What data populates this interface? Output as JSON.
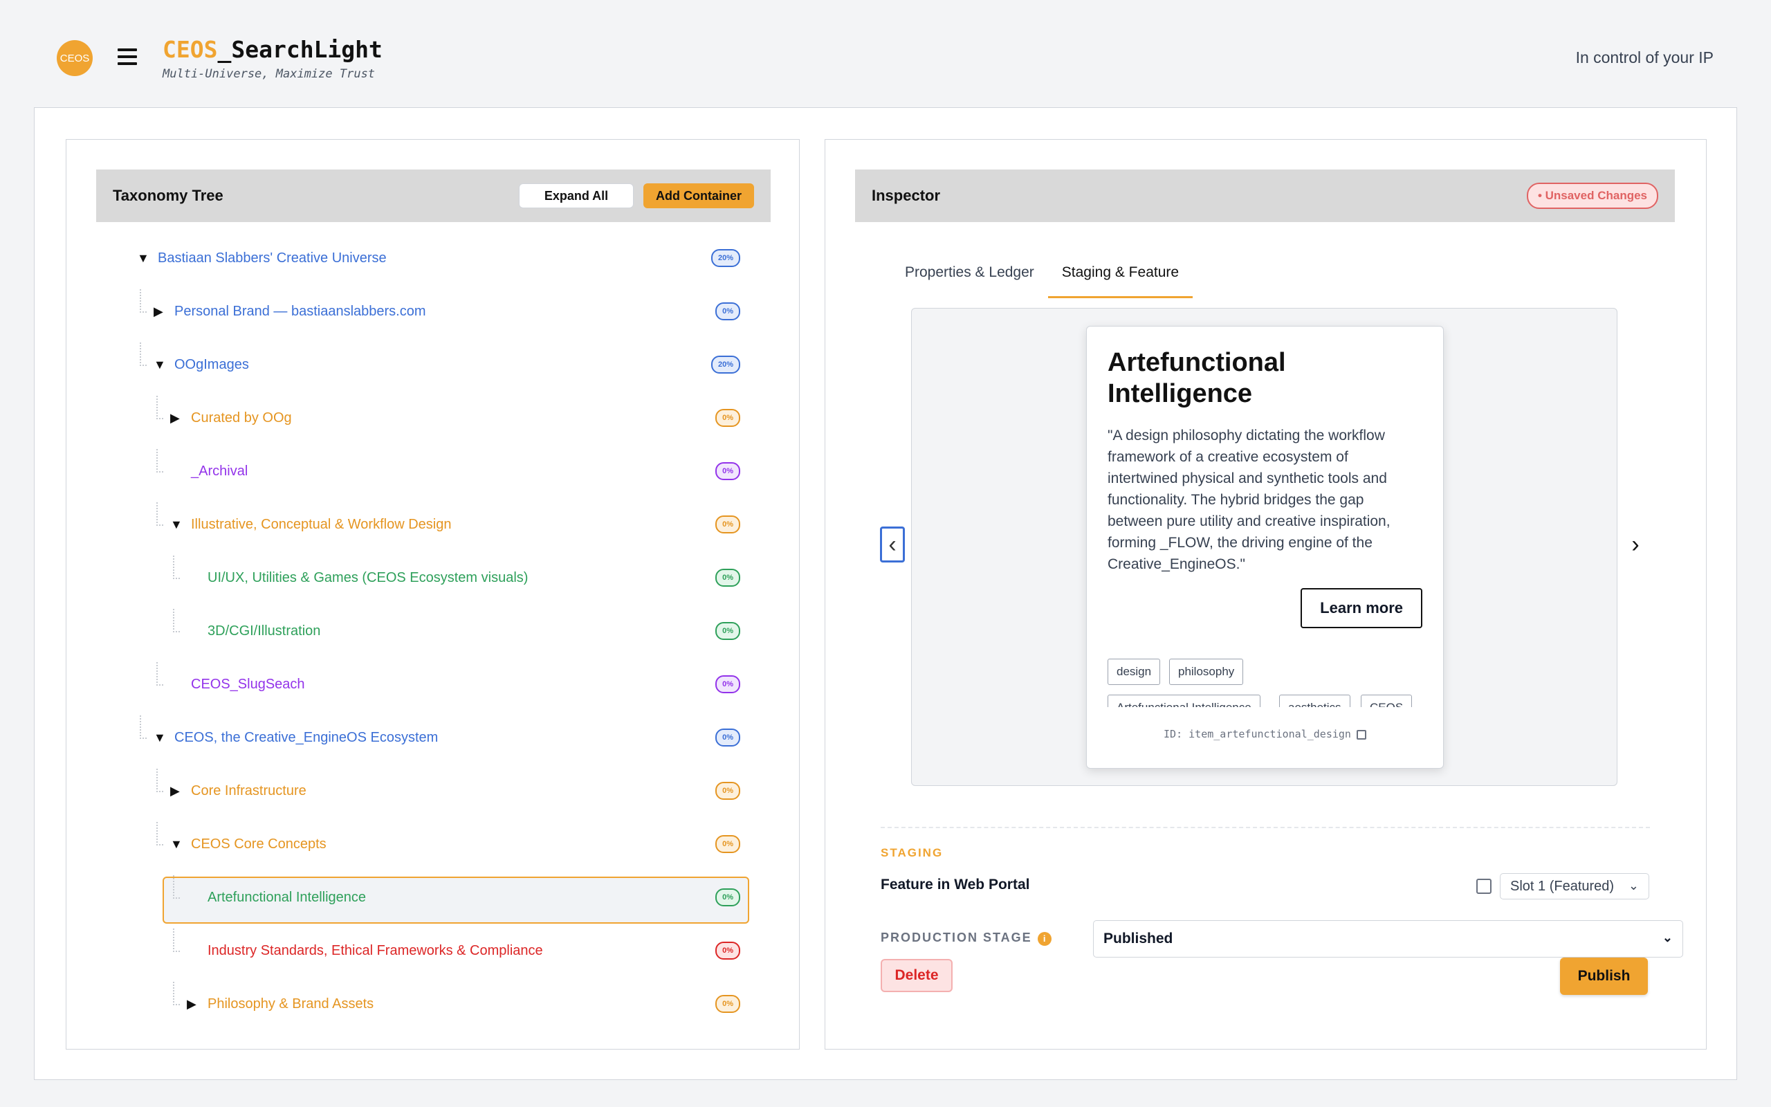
{
  "header": {
    "logo_text": "CEOS",
    "brand_accent": "CEOS",
    "brand_rest": "_SearchLight",
    "subtitle": "Multi-Universe, Maximize Trust",
    "tagline": "In control of your IP"
  },
  "taxonomy": {
    "title": "Taxonomy Tree",
    "expand_all": "Expand All",
    "add_container": "Add Container",
    "nodes": [
      {
        "label": "Bastiaan Slabbers' Creative Universe",
        "pct": "20%",
        "toggle": "▼",
        "color": "blue",
        "depth": 0
      },
      {
        "label": "Personal Brand — bastiaanslabbers.com",
        "pct": "0%",
        "toggle": "▶",
        "color": "blue",
        "depth": 1
      },
      {
        "label": "OOgImages",
        "pct": "20%",
        "toggle": "▼",
        "color": "blue",
        "depth": 1
      },
      {
        "label": "Curated by OOg",
        "pct": "0%",
        "toggle": "▶",
        "color": "orange",
        "depth": 2
      },
      {
        "label": "_Archival",
        "pct": "0%",
        "toggle": "",
        "color": "purple",
        "depth": 2
      },
      {
        "label": "Illustrative, Conceptual & Workflow Design",
        "pct": "0%",
        "toggle": "▼",
        "color": "orange",
        "depth": 2
      },
      {
        "label": "UI/UX, Utilities & Games (CEOS Ecosystem visuals)",
        "pct": "0%",
        "toggle": "",
        "color": "green",
        "depth": 3
      },
      {
        "label": "3D/CGI/Illustration",
        "pct": "0%",
        "toggle": "",
        "color": "green",
        "depth": 3
      },
      {
        "label": "CEOS_SlugSeach",
        "pct": "0%",
        "toggle": "",
        "color": "purple",
        "depth": 2
      },
      {
        "label": "CEOS, the Creative_EngineOS Ecosystem",
        "pct": "0%",
        "toggle": "▼",
        "color": "blue",
        "depth": 1
      },
      {
        "label": "Core Infrastructure",
        "pct": "0%",
        "toggle": "▶",
        "color": "orange",
        "depth": 2
      },
      {
        "label": "CEOS Core Concepts",
        "pct": "0%",
        "toggle": "▼",
        "color": "orange",
        "depth": 2
      },
      {
        "label": "Artefunctional Intelligence",
        "pct": "0%",
        "toggle": "",
        "color": "green",
        "depth": 3,
        "selected": true
      },
      {
        "label": "Industry Standards, Ethical Frameworks & Compliance",
        "pct": "0%",
        "toggle": "",
        "color": "red",
        "depth": 3
      },
      {
        "label": "Philosophy & Brand Assets",
        "pct": "0%",
        "toggle": "▶",
        "color": "orange",
        "depth": 3
      }
    ]
  },
  "inspector": {
    "title": "Inspector",
    "unsaved": "• Unsaved Changes",
    "tabs": [
      "Properties & Ledger",
      "Staging & Feature"
    ],
    "active_tab": 1,
    "card": {
      "title": "Artefunctional Intelligence",
      "description": "\"A design philosophy dictating the workflow framework of a creative ecosystem of intertwined physical and synthetic tools and functionality. The hybrid bridges the gap between pure utility and creative inspiration, forming _FLOW, the driving engine of the Creative_EngineOS.\"",
      "learn_more": "Learn more",
      "tags": [
        "design",
        "philosophy",
        "Artefunctional Intelligence",
        "aesthetics",
        "CEOS"
      ],
      "id_text": "ID: item_artefunctional_design"
    },
    "staging_label": "STAGING",
    "feature_label": "Feature in Web Portal",
    "feature_checked": false,
    "slot_value": "Slot 1 (Featured)",
    "production_label": "PRODUCTION STAGE",
    "production_value": "Published",
    "delete": "Delete",
    "publish": "Publish"
  },
  "colors": {
    "accent": "#f0a431",
    "blue": "#3b6fd6",
    "green": "#2ea05a",
    "purple": "#9333ea",
    "red": "#dc2626"
  }
}
